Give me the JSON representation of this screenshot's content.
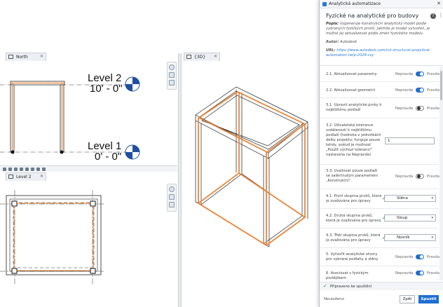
{
  "views": {
    "north": {
      "tab_label": "North",
      "level2_name": "Level 2",
      "level2_elev": "10' - 0\"",
      "level1_name": "Level 1",
      "level1_elev": "0' - 0\""
    },
    "three_d": {
      "tab_label": "{3D}"
    },
    "level2": {
      "tab_label": "Level 2"
    }
  },
  "dialog": {
    "window_title": "Analytická automatizace",
    "title": "Fyzické na analytické pro budovy",
    "description_label": "Popis:",
    "description": "Vygeneruje konstrukční analytický model podle vybraných fyzických prvků. Jakmile je model vytvořen, je možné jej aktualizovat podle změn fyzického modelu.",
    "author_label": "Autor:",
    "author": "Autodesk",
    "url_label": "URL:",
    "url": "https://www.autodesk.com/rvt-structural-analytical-automation-help-2026-csy",
    "off_label": "Nepravda",
    "on_label": "Pravda",
    "rows": [
      {
        "label": "2.1. Aktualizovat parametry",
        "type": "toggle",
        "value": "Pravda"
      },
      {
        "label": "2.2. Aktualizovat geometrii",
        "type": "toggle",
        "value": "Pravda"
      },
      {
        "label": "3.1. Upravit analytické prvky k nejbližšímu podlaží",
        "type": "toggle",
        "value": "Nepravda"
      },
      {
        "label": "3.2. Uživatelská tolerance vzdálenosti k nejbližšímu podlaží (hodnota v jednotkách délky projektu; funguje pouze tehdy, pokud je možnost „Použít výchozí toleranci“ nastavena na Nepravda)",
        "type": "number",
        "value": "1"
      },
      {
        "label": "3.3. Uvažovat pouze podlaží se zaškrtnutým parametrem „Konstrukční“.",
        "type": "toggle",
        "value": "Nepravda"
      },
      {
        "label": "4.1. První skupina prvků, která je zvažována pro úpravy",
        "type": "select",
        "value": "Stěna"
      },
      {
        "label": "4.2. Druhá skupina prvků, která je zvažována pro úpravy",
        "type": "select",
        "value": "Sloup"
      },
      {
        "label": "4.3. Třetí skupina prvků, která je zvažována pro úpravy",
        "type": "select",
        "value": "Nosník"
      },
      {
        "label": "5. Vytvořit analytické otvory pro vybrané podlahy a stěny",
        "type": "toggle",
        "value": "Pravda"
      },
      {
        "label": "6. Asociovat s fyzickým protějškem",
        "type": "toggle",
        "value": "Pravda"
      }
    ],
    "status": "Připraveno ke spuštění",
    "saved": "Neuloženo",
    "back_label": "Zpět",
    "run_label": "Spustit"
  },
  "colors": {
    "accent": "#1f6fd1",
    "analytical": "#e8863a",
    "ok": "#2a9a3a"
  }
}
